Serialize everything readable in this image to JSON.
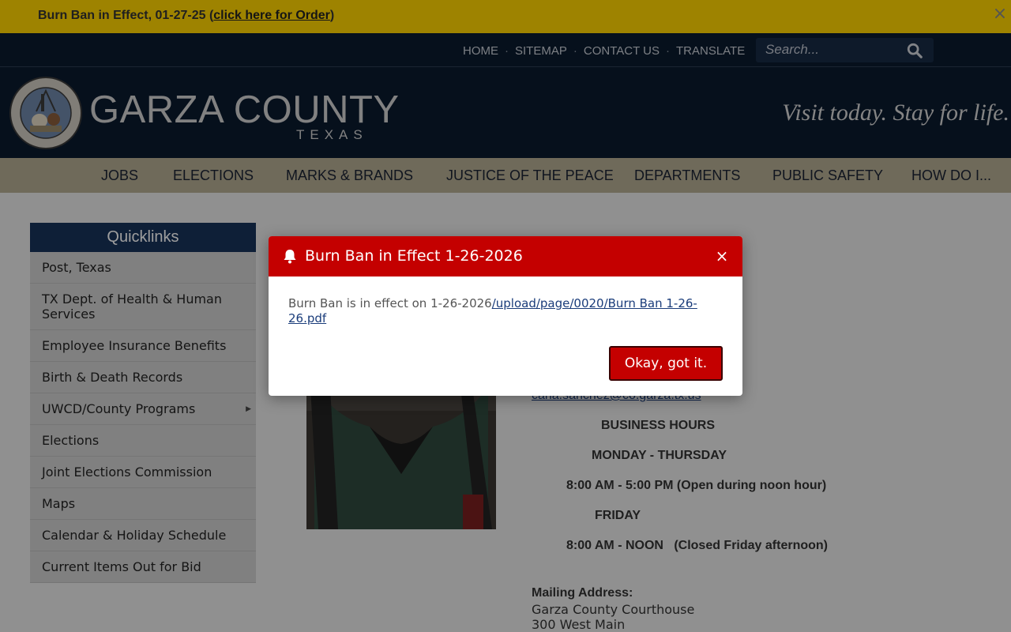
{
  "alert": {
    "text": "Burn Ban in Effect, 01-27-25 (",
    "link": "click here for Order",
    "text_end": ")",
    "close_icon": "close-icon"
  },
  "utility_nav": [
    "HOME",
    "SITEMAP",
    "CONTACT US",
    "TRANSLATE"
  ],
  "search": {
    "placeholder": "Search..."
  },
  "brand": {
    "name": "GARZA COUNTY",
    "state": "TEXAS",
    "tagline": "Visit today. Stay for life.",
    "seal_text_top": "COUNTY OF GARZA",
    "seal_text_bottom": "STATE OF TEXAS"
  },
  "main_nav": [
    "JOBS",
    "ELECTIONS",
    "MARKS & BRANDS",
    "JUSTICE OF THE PEACE",
    "DEPARTMENTS",
    "PUBLIC SAFETY",
    "HOW DO I..."
  ],
  "quicklinks": {
    "title": "Quicklinks",
    "items": [
      "Post, Texas",
      "TX Dept. of Health & Human Services",
      "Employee Insurance Benefits",
      "Birth & Death Records",
      "UWCD/County Programs",
      "Elections",
      "Joint Elections Commission",
      "Maps",
      "Calendar & Holiday Schedule",
      "Current Items Out for Bid"
    ]
  },
  "contact": {
    "email": "carla.sanchez@co.garza.tx.us",
    "hours_title": "BUSINESS HOURS",
    "days1": "MONDAY - THURSDAY",
    "hours1": "8:00 AM - 5:00 PM (Open during noon hour)",
    "days2": "FRIDAY",
    "hours2": "8:00 AM - NOON   (Closed Friday afternoon)",
    "mailing_label": "Mailing Address:",
    "mailing_line1": "Garza County Courthouse",
    "mailing_line2": "300 West Main"
  },
  "modal": {
    "title": "Burn Ban in Effect 1-26-2026",
    "body_text": "Burn Ban is in effect on 1-26-2026",
    "body_link": "/upload/page/0020/Burn Ban 1-26-26.pdf",
    "ok_label": "Okay, got it.",
    "icon": "bell-icon"
  },
  "colors": {
    "alert_bar": "#ffd400",
    "header_bg": "#0b1a2e",
    "nav_bg": "#b4ab92",
    "quicklinks_header": "#17325a",
    "modal_accent": "#c40000"
  }
}
